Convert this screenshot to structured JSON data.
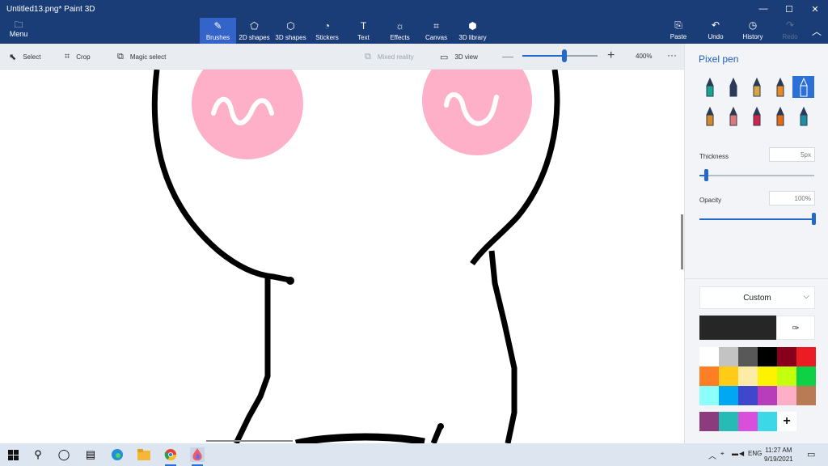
{
  "window": {
    "title": "Untitled13.png*   Paint 3D"
  },
  "window_controls": {
    "minimize": "—",
    "maximize": "☐",
    "close": "✕"
  },
  "menu": {
    "label": "Menu",
    "icon": "folder-icon"
  },
  "tabs": [
    {
      "label": "Brushes",
      "icon": "brush-icon",
      "glyph": "✎",
      "active": true
    },
    {
      "label": "2D shapes",
      "icon": "2d-shapes-icon",
      "glyph": "⬠",
      "active": false
    },
    {
      "label": "3D shapes",
      "icon": "3d-shapes-icon",
      "glyph": "⬡",
      "active": false
    },
    {
      "label": "Stickers",
      "icon": "stickers-icon",
      "glyph": "◔",
      "active": false
    },
    {
      "label": "Text",
      "icon": "text-icon",
      "glyph": "T",
      "active": false
    },
    {
      "label": "Effects",
      "icon": "effects-icon",
      "glyph": "☼",
      "active": false
    },
    {
      "label": "Canvas",
      "icon": "canvas-icon",
      "glyph": "⌗",
      "active": false
    },
    {
      "label": "3D library",
      "icon": "3d-library-icon",
      "glyph": "⬢",
      "active": false
    }
  ],
  "actions": [
    {
      "label": "Paste",
      "icon": "paste-icon",
      "glyph": "⎘",
      "disabled": false
    },
    {
      "label": "Undo",
      "icon": "undo-icon",
      "glyph": "↶",
      "disabled": false
    },
    {
      "label": "History",
      "icon": "history-icon",
      "glyph": "◷",
      "disabled": false
    },
    {
      "label": "Redo",
      "icon": "redo-icon",
      "glyph": "↷",
      "disabled": true
    }
  ],
  "toolbar": {
    "select": "Select",
    "crop": "Crop",
    "magic_select": "Magic select",
    "mixed_reality": "Mixed reality",
    "view_3d": "3D view",
    "zoom_minus": "—",
    "zoom_plus": "+",
    "zoom_value": "400%",
    "zoom_level": 0.56,
    "more": "···"
  },
  "panel": {
    "title": "Pixel pen",
    "brushes": [
      {
        "name": "marker-brush",
        "color": "#1aa58e",
        "active": false
      },
      {
        "name": "calligraphy-pen-brush",
        "color": "#2a3a56",
        "active": false
      },
      {
        "name": "oil-brush",
        "color": "#d9a441",
        "active": false
      },
      {
        "name": "watercolor-brush",
        "color": "#e88a22",
        "active": false
      },
      {
        "name": "pixel-pen-brush",
        "color": "#ffffff",
        "active": true
      },
      {
        "name": "pencil-brush",
        "color": "#d48a2a",
        "active": false
      },
      {
        "name": "eraser-brush",
        "color": "#e07878",
        "active": false
      },
      {
        "name": "crayon-brush",
        "color": "#d2244a",
        "active": false
      },
      {
        "name": "spray-can-brush",
        "color": "#e86a10",
        "active": false
      },
      {
        "name": "fill-brush",
        "color": "#1e8fa0",
        "active": false
      }
    ],
    "thickness_label": "Thickness",
    "thickness_value": "5px",
    "thickness_level": 0.06,
    "opacity_label": "Opacity",
    "opacity_value": "100%",
    "opacity_level": 1.0,
    "color_mode": "Custom",
    "current_color": "#262626",
    "palette": [
      "#ffffff",
      "#c3c3c3",
      "#585858",
      "#000000",
      "#88001b",
      "#ec1c24",
      "#ff7f27",
      "#ffca18",
      "#fdeca6",
      "#fff200",
      "#c4ff0e",
      "#0ed145",
      "#8cfffb",
      "#00a8f3",
      "#3f48cc",
      "#b83dba",
      "#ffaec8",
      "#b97a56"
    ],
    "custom_colors": [
      "#8c3b7c",
      "#26bbb4",
      "#d84fdc",
      "#3dd8e8"
    ],
    "add_color": "+"
  },
  "taskbar": {
    "language": "ENG",
    "time": "11:27 AM",
    "date": "9/19/2021"
  }
}
